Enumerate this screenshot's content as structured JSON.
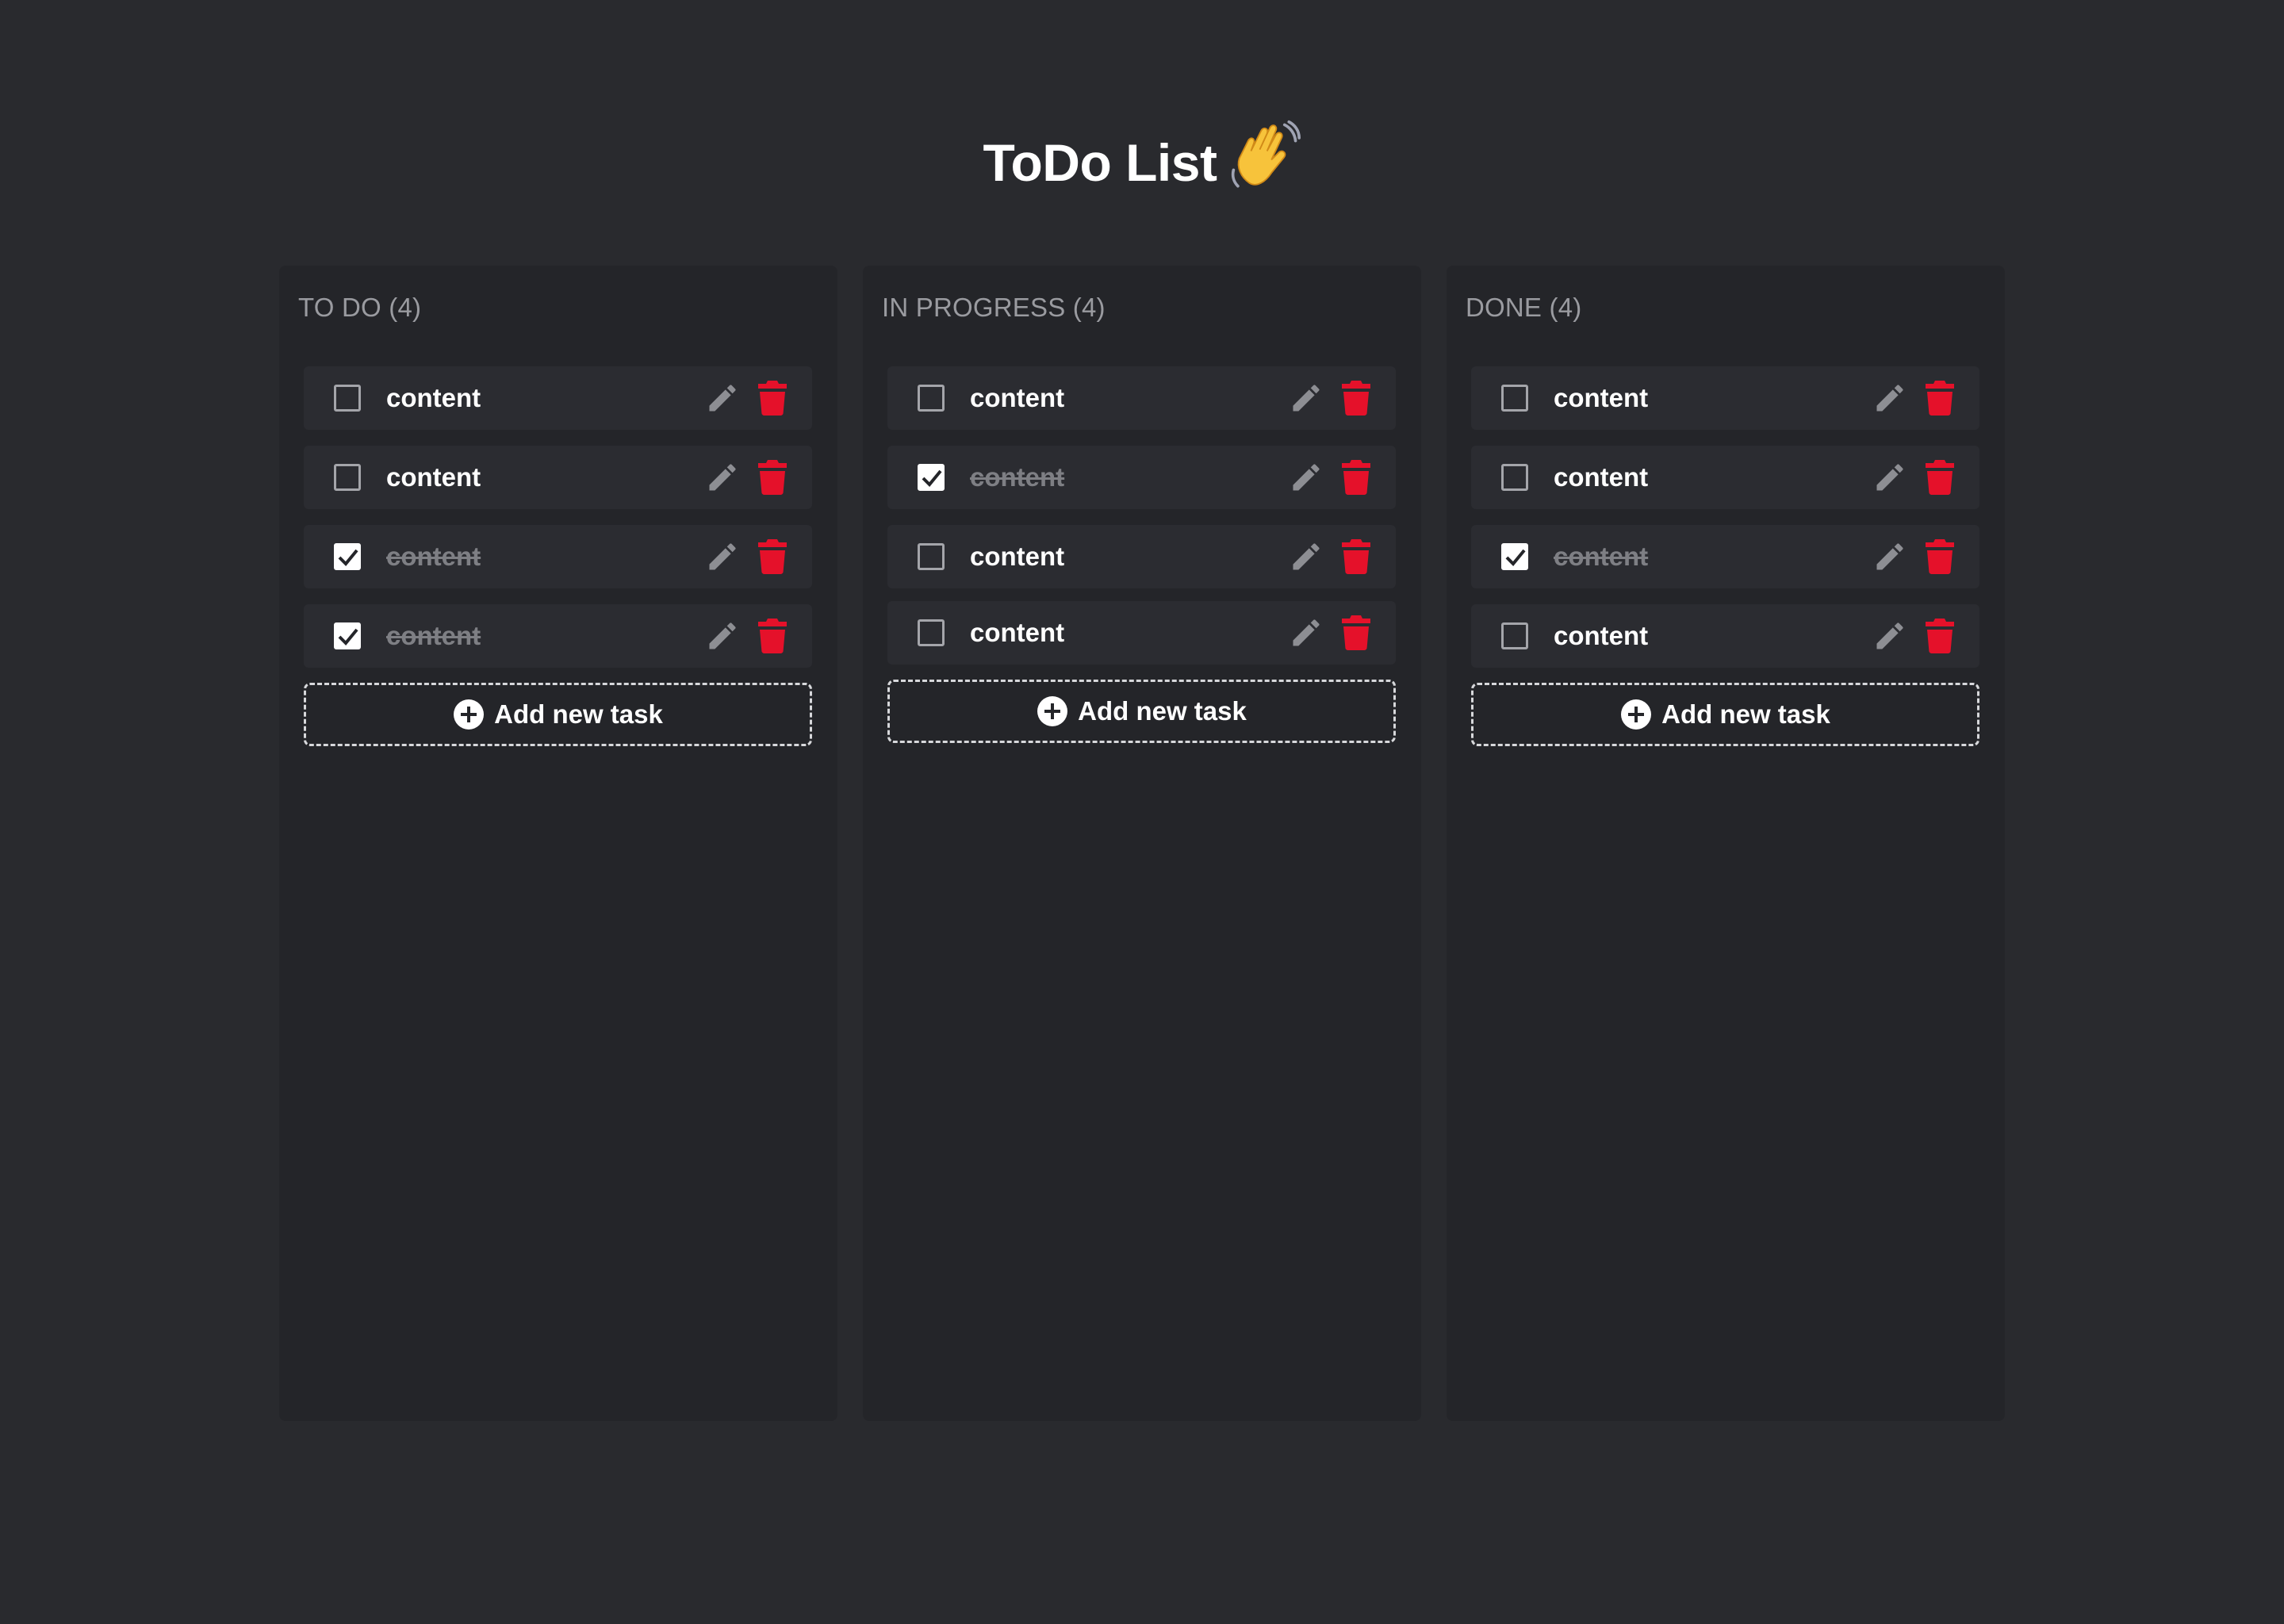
{
  "page": {
    "title": "ToDo List",
    "title_emoji": "waving-hand-icon"
  },
  "colors": {
    "background": "#292a2e",
    "column_bg": "#242529",
    "task_bg": "#2b2c31",
    "delete_red": "#e5112a",
    "edit_gray": "#8d8e93",
    "header_gray": "#9a9ba0"
  },
  "columns": [
    {
      "title": "TO DO (4)",
      "add_label": "Add new task",
      "tasks": [
        {
          "text": "content",
          "done": false
        },
        {
          "text": "content",
          "done": false
        },
        {
          "text": "content",
          "done": true
        },
        {
          "text": "content",
          "done": true
        }
      ]
    },
    {
      "title": "IN PROGRESS (4)",
      "add_label": "Add new task",
      "tasks": [
        {
          "text": "content",
          "done": false
        },
        {
          "text": "content",
          "done": true
        },
        {
          "text": "content",
          "done": false
        },
        {
          "text": "content",
          "done": false
        }
      ]
    },
    {
      "title": "DONE (4)",
      "add_label": "Add new task",
      "tasks": [
        {
          "text": "content",
          "done": false
        },
        {
          "text": "content",
          "done": false
        },
        {
          "text": "content",
          "done": true
        },
        {
          "text": "content",
          "done": false
        }
      ]
    }
  ],
  "icons": {
    "edit": "pencil-icon",
    "delete": "trash-icon",
    "add": "plus-circle-icon"
  }
}
